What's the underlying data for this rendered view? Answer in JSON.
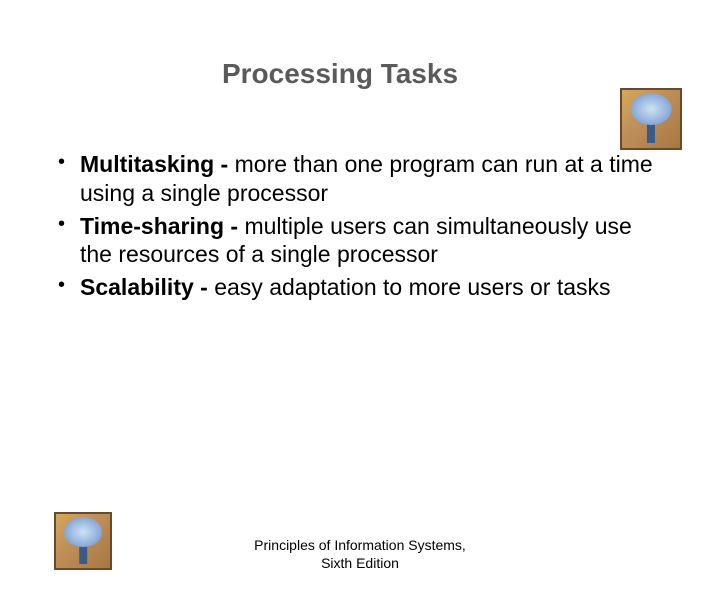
{
  "title": "Processing Tasks",
  "bullets": [
    {
      "term": "Multitasking - ",
      "desc": "more than one program can run at a time using a single processor"
    },
    {
      "term": "Time-sharing - ",
      "desc": "multiple users can simultaneously use the resources of a single processor"
    },
    {
      "term": "Scalability - ",
      "desc": "easy adaptation to more users or tasks"
    }
  ],
  "footer": {
    "line1": "Principles of Information Systems,",
    "line2": "Sixth Edition"
  }
}
